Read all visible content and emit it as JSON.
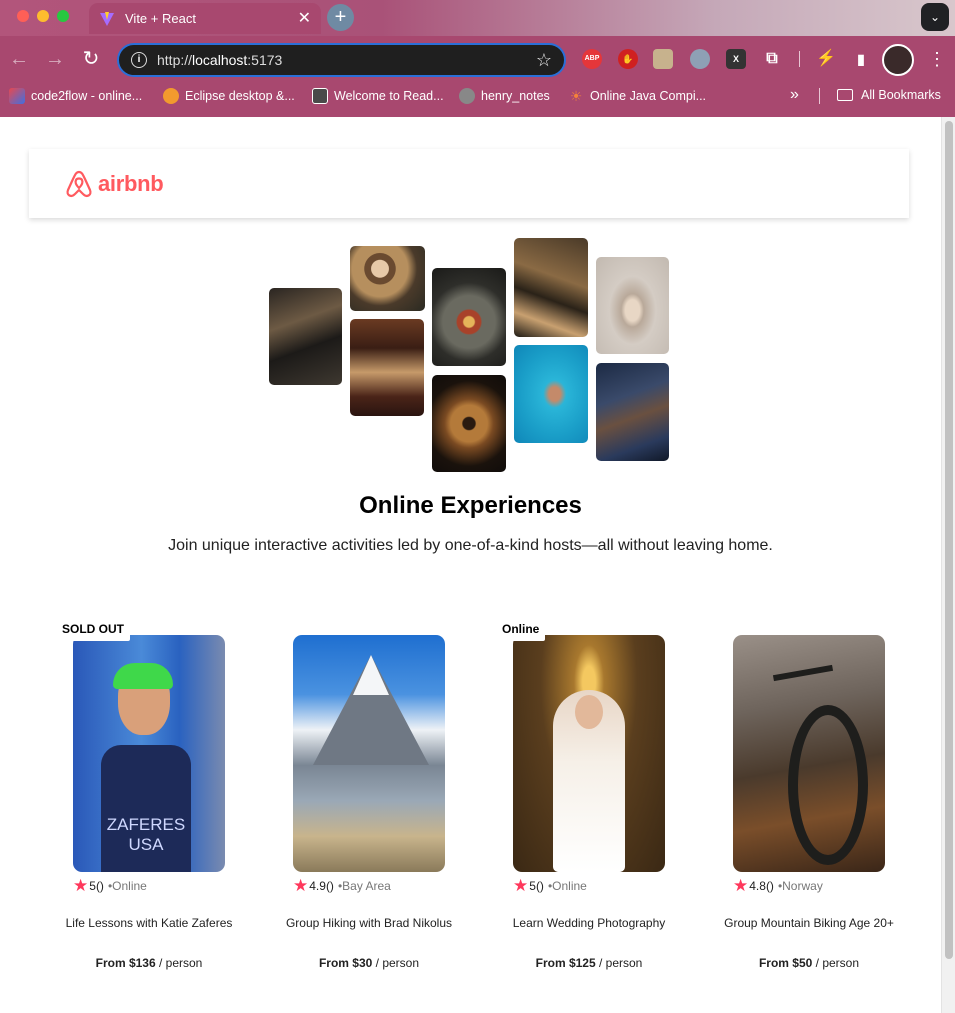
{
  "browser": {
    "tab_title": "Vite + React",
    "url_prefix": "http://",
    "url_host": "localhost",
    "url_port": ":5173",
    "bookmarks": [
      {
        "label": "code2flow - online..."
      },
      {
        "label": "Eclipse desktop &..."
      },
      {
        "label": "Welcome to Read..."
      },
      {
        "label": "henry_notes"
      },
      {
        "label": "Online Java Compi..."
      }
    ],
    "all_bookmarks": "All Bookmarks",
    "ext_abp": "ABP",
    "ext_x": "X"
  },
  "navbar": {
    "logo_text": "airbnb",
    "brand_color": "#ff5a5f"
  },
  "hero": {
    "title": "Online Experiences",
    "subtitle": "Join unique interactive activities led by one-of-a-kind hosts—all without leaving home."
  },
  "cards": [
    {
      "badge": "SOLD OUT",
      "rating": "5",
      "reviews": "()",
      "location": "•Online",
      "title": "Life Lessons with Katie Zaferes",
      "price": "From $136",
      "per": " / person",
      "jersey": "ZAFERES USA"
    },
    {
      "badge": "",
      "rating": "4.9",
      "reviews": "()",
      "location": "•Bay Area",
      "title": "Group Hiking with Brad Nikolus",
      "price": "From $30",
      "per": " / person"
    },
    {
      "badge": "Online",
      "rating": "5",
      "reviews": "()",
      "location": "•Online",
      "title": "Learn Wedding Photography",
      "price": "From $125",
      "per": " / person"
    },
    {
      "badge": "",
      "rating": "4.8",
      "reviews": "()",
      "location": "•Norway",
      "title": "Group Mountain Biking Age 20+",
      "price": "From $50",
      "per": " / person"
    }
  ],
  "colors": {
    "chrome": "#a8486f",
    "star": "#fe385c",
    "accent_url_border": "#2a6fd8"
  }
}
